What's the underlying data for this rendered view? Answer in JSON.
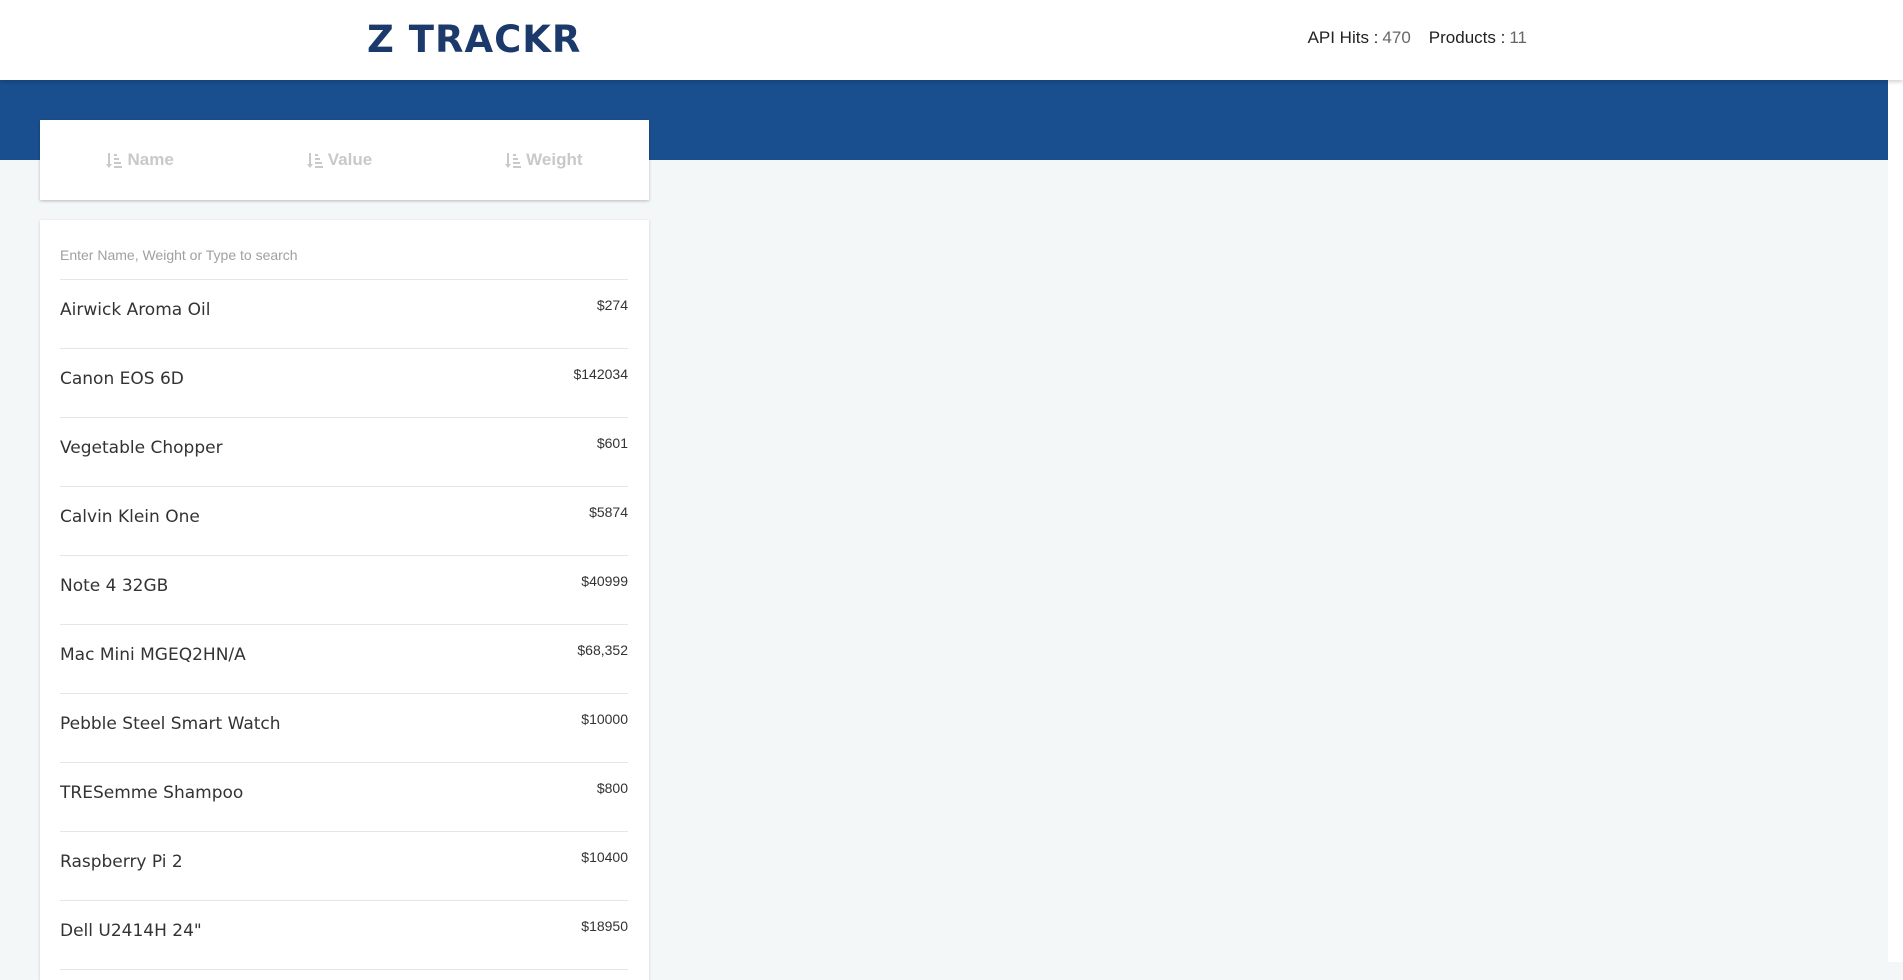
{
  "header": {
    "logo": "Z TRACKR",
    "api_hits_label": "API Hits :",
    "api_hits_value": "470",
    "products_label": "Products :",
    "products_value": "11"
  },
  "sort": {
    "icon": "sort-amount-down-icon",
    "buttons": [
      {
        "label": "Name"
      },
      {
        "label": "Value"
      },
      {
        "label": "Weight"
      }
    ]
  },
  "search": {
    "placeholder": "Enter Name, Weight or Type to search",
    "value": ""
  },
  "products": [
    {
      "name": "Airwick Aroma Oil",
      "price": "$274"
    },
    {
      "name": "Canon EOS 6D",
      "price": "$142034"
    },
    {
      "name": "Vegetable Chopper",
      "price": "$601"
    },
    {
      "name": "Calvin Klein One",
      "price": "$5874"
    },
    {
      "name": "Note 4 32GB",
      "price": "$40999"
    },
    {
      "name": "Mac Mini MGEQ2HN/A",
      "price": "$68,352"
    },
    {
      "name": "Pebble Steel Smart Watch",
      "price": "$10000"
    },
    {
      "name": "TRESemme Shampoo",
      "price": "$800"
    },
    {
      "name": "Raspberry Pi 2",
      "price": "$10400"
    },
    {
      "name": "Dell U2414H 24\"",
      "price": "$18950"
    }
  ],
  "colors": {
    "brand": "#1b3a6b",
    "band": "#1a4f8f",
    "background": "#f4f7f8",
    "sort_label": "#c9c9c9"
  }
}
